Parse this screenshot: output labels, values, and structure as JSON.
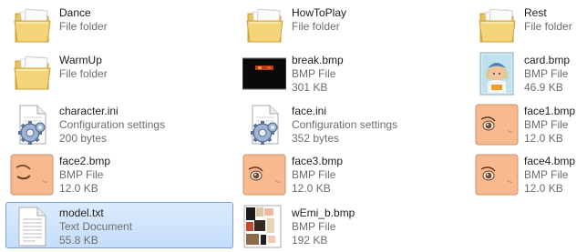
{
  "files": [
    {
      "name": "Dance",
      "type": "File folder",
      "size": "",
      "icon": "folder-icon",
      "selected": false
    },
    {
      "name": "HowToPlay",
      "type": "File folder",
      "size": "",
      "icon": "folder-icon",
      "selected": false
    },
    {
      "name": "Rest",
      "type": "File folder",
      "size": "",
      "icon": "folder-icon",
      "selected": false
    },
    {
      "name": "WarmUp",
      "type": "File folder",
      "size": "",
      "icon": "folder-icon",
      "selected": false
    },
    {
      "name": "break.bmp",
      "type": "BMP File",
      "size": "301 KB",
      "icon": "dark-image-thumbnail-icon",
      "selected": false
    },
    {
      "name": "card.bmp",
      "type": "BMP File",
      "size": "46.9 KB",
      "icon": "character-card-thumbnail-icon",
      "selected": false
    },
    {
      "name": "character.ini",
      "type": "Configuration settings",
      "size": "200 bytes",
      "icon": "config-file-icon",
      "selected": false
    },
    {
      "name": "face.ini",
      "type": "Configuration settings",
      "size": "352 bytes",
      "icon": "config-file-icon",
      "selected": false
    },
    {
      "name": "face1.bmp",
      "type": "BMP File",
      "size": "12.0 KB",
      "icon": "face-thumbnail-icon",
      "selected": false
    },
    {
      "name": "face2.bmp",
      "type": "BMP File",
      "size": "12.0 KB",
      "icon": "face-closed-eye-thumbnail-icon",
      "selected": false
    },
    {
      "name": "face3.bmp",
      "type": "BMP File",
      "size": "12.0 KB",
      "icon": "face-thumbnail-icon",
      "selected": false
    },
    {
      "name": "face4.bmp",
      "type": "BMP File",
      "size": "12.0 KB",
      "icon": "face-thumbnail-icon",
      "selected": false
    },
    {
      "name": "model.txt",
      "type": "Text Document",
      "size": "55.8 KB",
      "icon": "text-document-icon",
      "selected": true
    },
    {
      "name": "wEmi_b.bmp",
      "type": "BMP File",
      "size": "192 KB",
      "icon": "texture-thumbnail-icon",
      "selected": false
    }
  ],
  "colors": {
    "selection_background": "#cce0fa",
    "selection_border": "#7da2ce",
    "secondary_text": "#6d6d6d"
  }
}
